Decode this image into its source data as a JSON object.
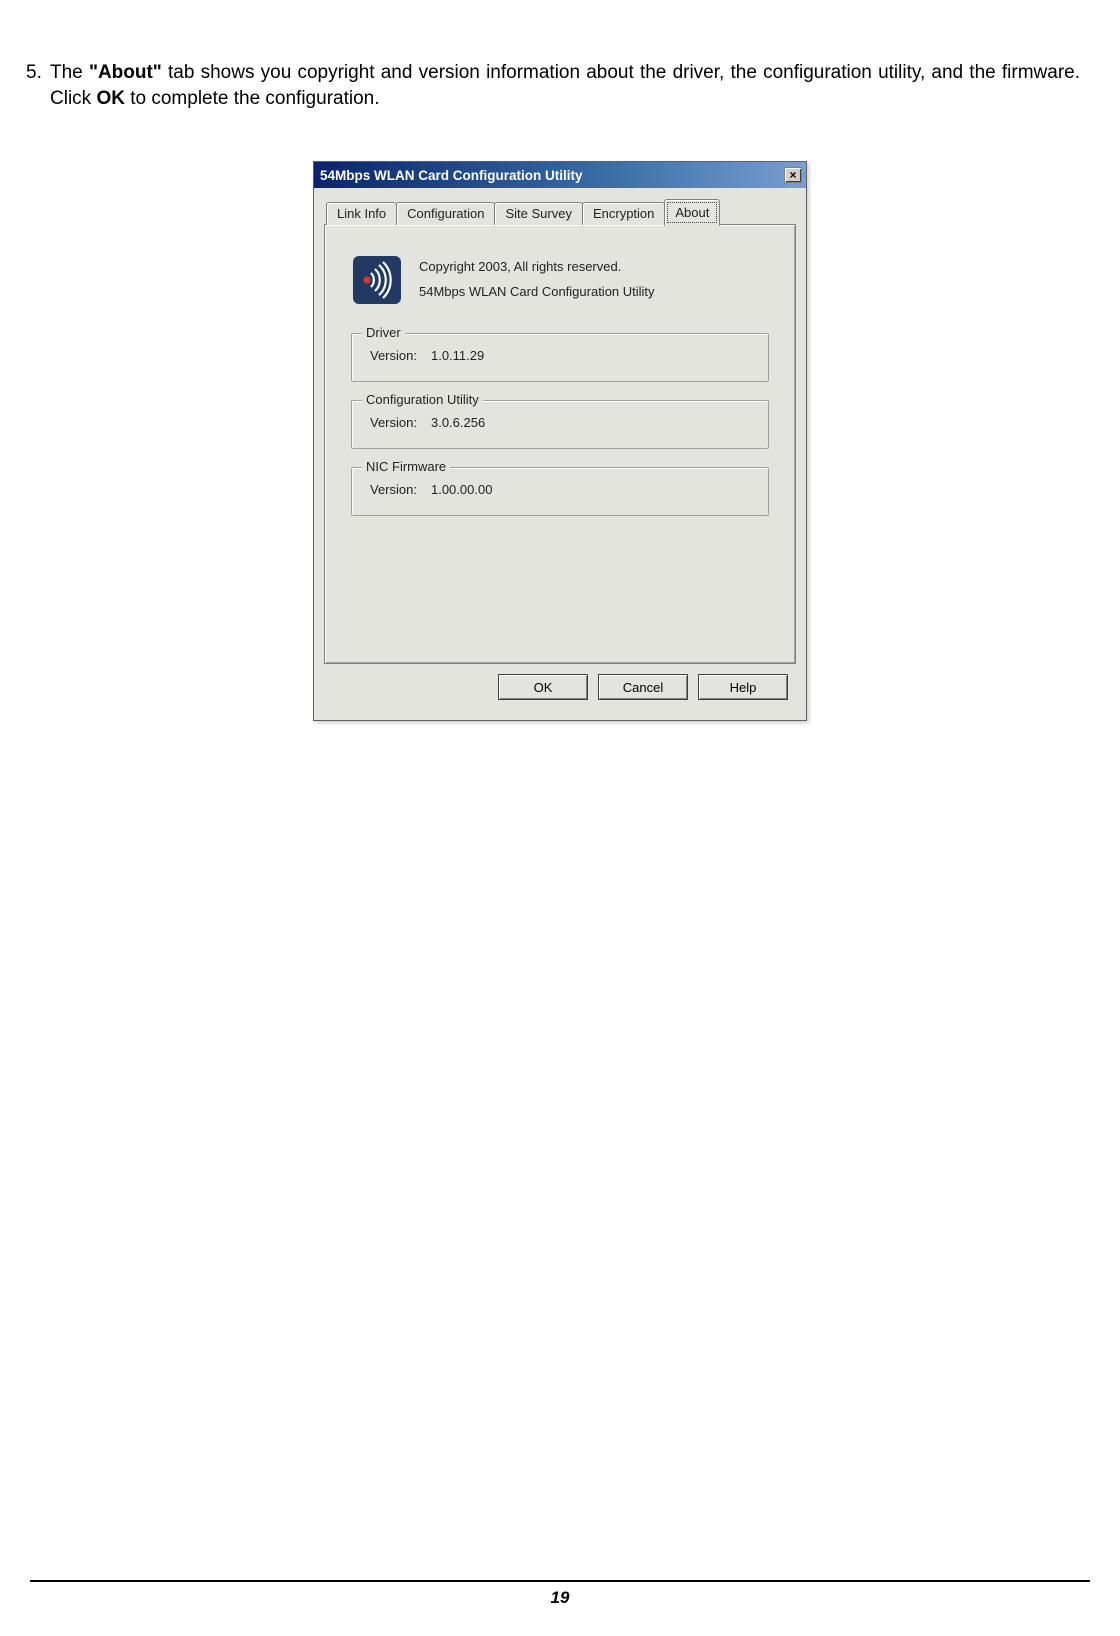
{
  "doc": {
    "list_num": "5.",
    "text_pre": "The ",
    "text_about": "\"About\"",
    "text_mid": " tab shows you copyright and version information about the driver, the configuration utility, and the firmware. Click ",
    "text_ok": "OK",
    "text_post": " to complete the configuration.",
    "page_number": "19"
  },
  "dialog": {
    "title": "54Mbps WLAN Card Configuration Utility",
    "close": "×",
    "tabs": {
      "link_info": "Link Info",
      "configuration": "Configuration",
      "site_survey": "Site Survey",
      "encryption": "Encryption",
      "about": "About"
    },
    "about": {
      "copyright_line": "Copyright 2003, All rights reserved.",
      "product_line": "54Mbps WLAN Card Configuration Utility"
    },
    "groups": {
      "driver": {
        "legend": "Driver",
        "label": "Version:",
        "value": "1.0.11.29"
      },
      "config": {
        "legend": "Configuration Utility",
        "label": "Version:",
        "value": "3.0.6.256"
      },
      "firmware": {
        "legend": "NIC Firmware",
        "label": "Version:",
        "value": "1.00.00.00"
      }
    },
    "buttons": {
      "ok": "OK",
      "cancel": "Cancel",
      "help": "Help"
    }
  }
}
